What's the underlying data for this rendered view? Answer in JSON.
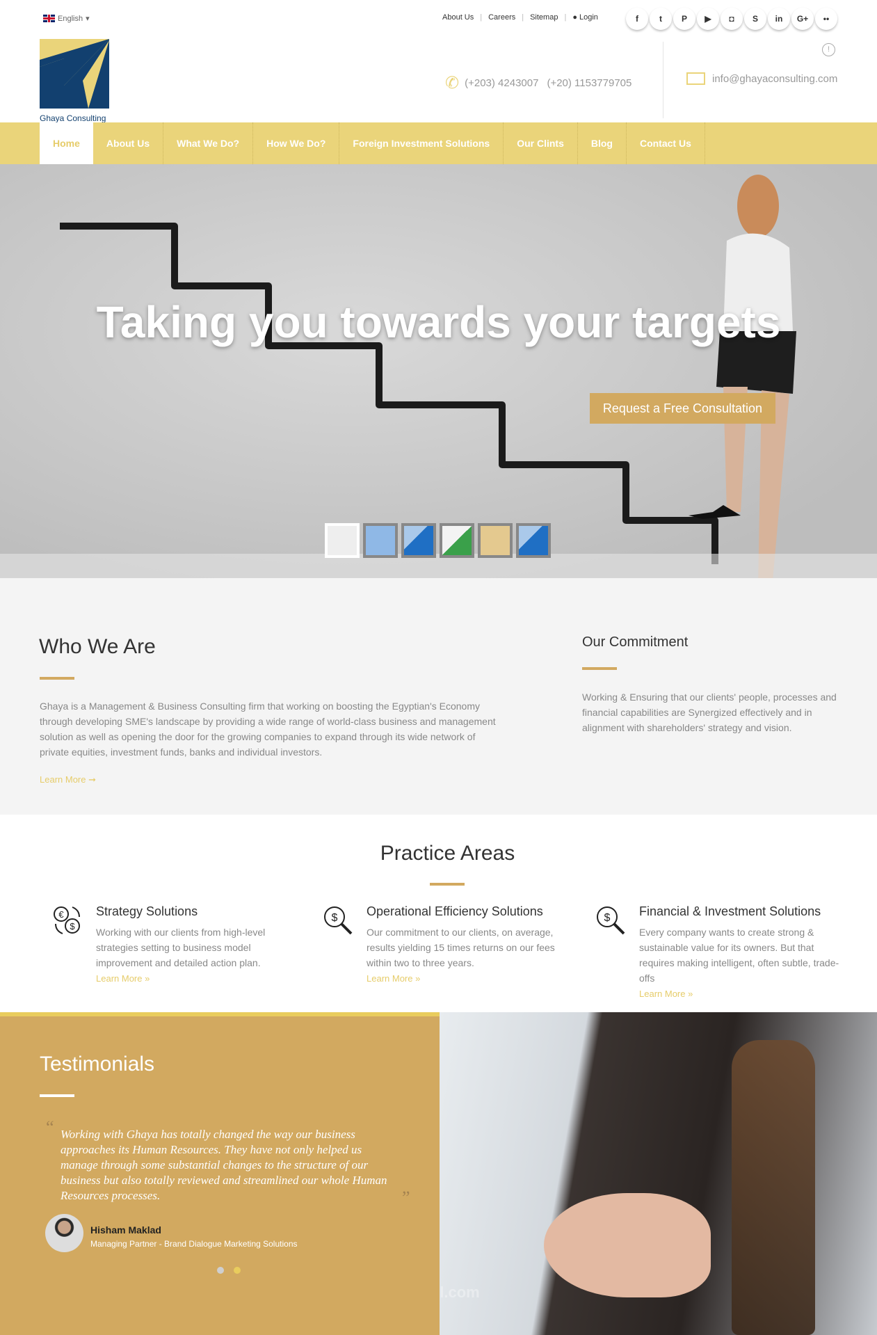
{
  "topbar": {
    "language": "English",
    "links": [
      "About Us",
      "Careers",
      "Sitemap",
      "Login"
    ],
    "social": [
      {
        "icon": "facebook-icon",
        "glyph": "f"
      },
      {
        "icon": "twitter-icon",
        "glyph": "t"
      },
      {
        "icon": "pinterest-icon",
        "glyph": "P"
      },
      {
        "icon": "youtube-icon",
        "glyph": "▶"
      },
      {
        "icon": "instagram-icon",
        "glyph": "◘"
      },
      {
        "icon": "skype-icon",
        "glyph": "S"
      },
      {
        "icon": "linkedin-icon",
        "glyph": "in"
      },
      {
        "icon": "google-plus-icon",
        "glyph": "G+"
      },
      {
        "icon": "flickr-icon",
        "glyph": "••"
      }
    ]
  },
  "header": {
    "logo_text": "Ghaya Consulting",
    "phone1": "(+203) 4243007",
    "phone2": "(+20) 1153779705",
    "email": "info@ghayaconsulting.com"
  },
  "nav": [
    "Home",
    "About Us",
    "What We Do?",
    "How We Do?",
    "Foreign Investment Solutions",
    "Our Clints",
    "Blog",
    "Contact Us"
  ],
  "hero": {
    "title": "Taking you towards your targets",
    "cta": "Request a Free Consultation"
  },
  "who": {
    "title": "Who We Are",
    "text": "Ghaya is a Management & Business Consulting firm that working on boosting the Egyptian's Economy through developing SME's landscape by providing a wide range of world-class business and management solution as well as opening the door for the growing companies to expand through its wide network of private equities, investment funds, banks and individual investors.",
    "learn_more": "Learn More ➞"
  },
  "commitment": {
    "title": "Our Commitment",
    "text": "Working & Ensuring that our clients' people, processes and financial capabilities are Synergized effectively and in alignment with shareholders' strategy and vision."
  },
  "practice": {
    "title": "Practice Areas",
    "items": [
      {
        "title": "Strategy Solutions",
        "text": "Working with our clients from high-level strategies setting to business model improvement and detailed action plan.",
        "link": "Learn More »"
      },
      {
        "title": "Operational Efficiency Solutions",
        "text": "Our commitment to our clients, on average, results yielding 15 times returns on our fees within two to three years.",
        "link": "Learn More »"
      },
      {
        "title": "Financial & Investment Solutions",
        "text": "Every company wants to create strong & sustainable value for its owners. But that requires making intelligent, often subtle, trade-offs",
        "link": "Learn More »"
      }
    ]
  },
  "testimonials": {
    "title": "Testimonials",
    "quote": "Working with Ghaya has totally changed the way our business approaches its Human Resources. They have not only helped us manage through some substantial changes to the structure of our business but also totally reviewed and streamlined our whole Human Resources processes.",
    "name": "Hisham Maklad",
    "role": "Managing Partner - Brand Dialogue Marketing Solutions"
  },
  "watermark": "mostaql.com",
  "colors": {
    "gold": "#d2a960",
    "nav_yellow": "#ead47a",
    "link_yellow": "#e6cc6a",
    "logo_blue": "#12406f"
  }
}
